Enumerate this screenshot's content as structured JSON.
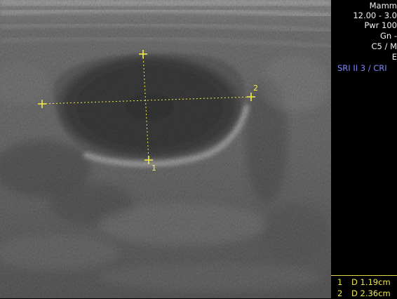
{
  "scanner_params": [
    "Mamm",
    "12.00 - 3.0",
    "Pwr 100",
    "Gn -",
    "C5 / M",
    "E"
  ],
  "processing_label": "SRI II 3 / CRI",
  "calipers": [
    {
      "id": "1",
      "label": "1"
    },
    {
      "id": "2",
      "label": "2"
    }
  ],
  "measurements": [
    {
      "index": "1",
      "text": "D 1.19cm"
    },
    {
      "index": "2",
      "text": "D 2.36cm"
    }
  ],
  "colors": {
    "caliper": "#f0e94a",
    "text": "#f2f2f2",
    "processing_label": "#7b87ff",
    "background": "#000000"
  }
}
